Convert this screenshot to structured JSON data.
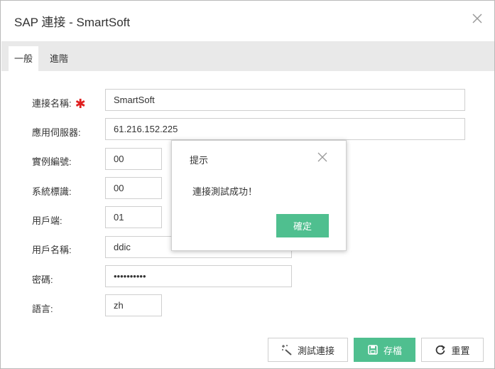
{
  "dialog": {
    "title": "SAP 連接 - SmartSoft",
    "close_icon": "close-icon"
  },
  "tabs": [
    {
      "label": "一般",
      "active": true
    },
    {
      "label": "進階",
      "active": false
    }
  ],
  "form": {
    "connection_name": {
      "label": "連接名稱:",
      "value": "SmartSoft",
      "required": true
    },
    "app_server": {
      "label": "應用伺服器:",
      "value": "61.216.152.225"
    },
    "instance_no": {
      "label": "實例編號:",
      "value": "00"
    },
    "system_id": {
      "label": "系統標識:",
      "value": "00"
    },
    "client": {
      "label": "用戶端:",
      "value": "01"
    },
    "username": {
      "label": "用戶名稱:",
      "value": "ddic"
    },
    "password": {
      "label": "密碼:",
      "value": "••••••••••"
    },
    "language": {
      "label": "語言:",
      "value": "zh"
    }
  },
  "message_box": {
    "title": "提示",
    "message": "連接測試成功！",
    "ok_label": "確定"
  },
  "buttons": {
    "test_label": "測試連接",
    "save_label": "存檔",
    "reset_label": "重置"
  },
  "colors": {
    "accent": "#4fbf8f",
    "required": "#e02020",
    "tabbar_bg": "#e9e9e9"
  }
}
